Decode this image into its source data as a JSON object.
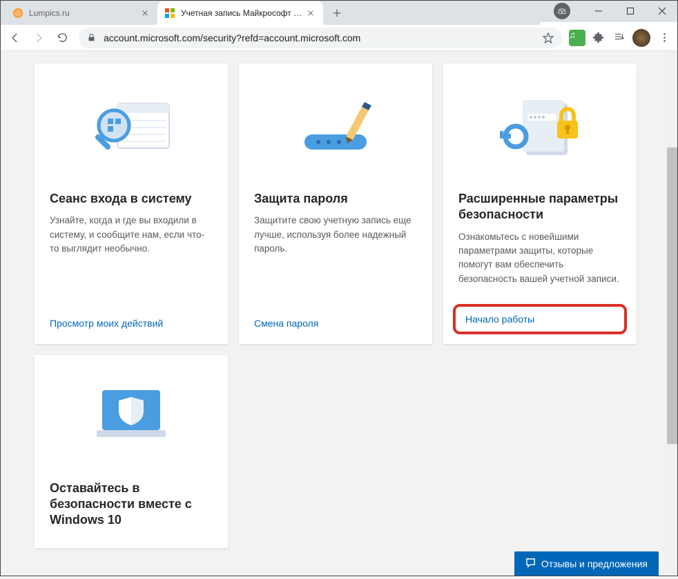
{
  "window": {
    "minimize": "—",
    "maximize": "□",
    "close": "✕"
  },
  "tabs": [
    {
      "title": "Lumpics.ru",
      "active": false
    },
    {
      "title": "Учетная запись Майкрософт | S",
      "active": true
    }
  ],
  "toolbar": {
    "url": "account.microsoft.com/security?refd=account.microsoft.com"
  },
  "cards": [
    {
      "title": "Сеанс входа в систему",
      "desc": "Узнайте, когда и где вы входили в систему, и сообщите нам, если что-то выглядит необычно.",
      "link": "Просмотр моих действий"
    },
    {
      "title": "Защита пароля",
      "desc": "Защитите свою учетную запись еще лучше, используя более надежный пароль.",
      "link": "Смена пароля"
    },
    {
      "title": "Расширенные параметры безопасности",
      "desc": "Ознакомьтесь с новейшими параметрами защиты, которые помогут вам обеспечить безопасность вашей учетной записи.",
      "link": "Начало работы"
    },
    {
      "title": "Оставайтесь в безопасности вместе с Windows 10",
      "desc": "",
      "link": ""
    }
  ],
  "feedback": {
    "label": "Отзывы и предложения"
  }
}
